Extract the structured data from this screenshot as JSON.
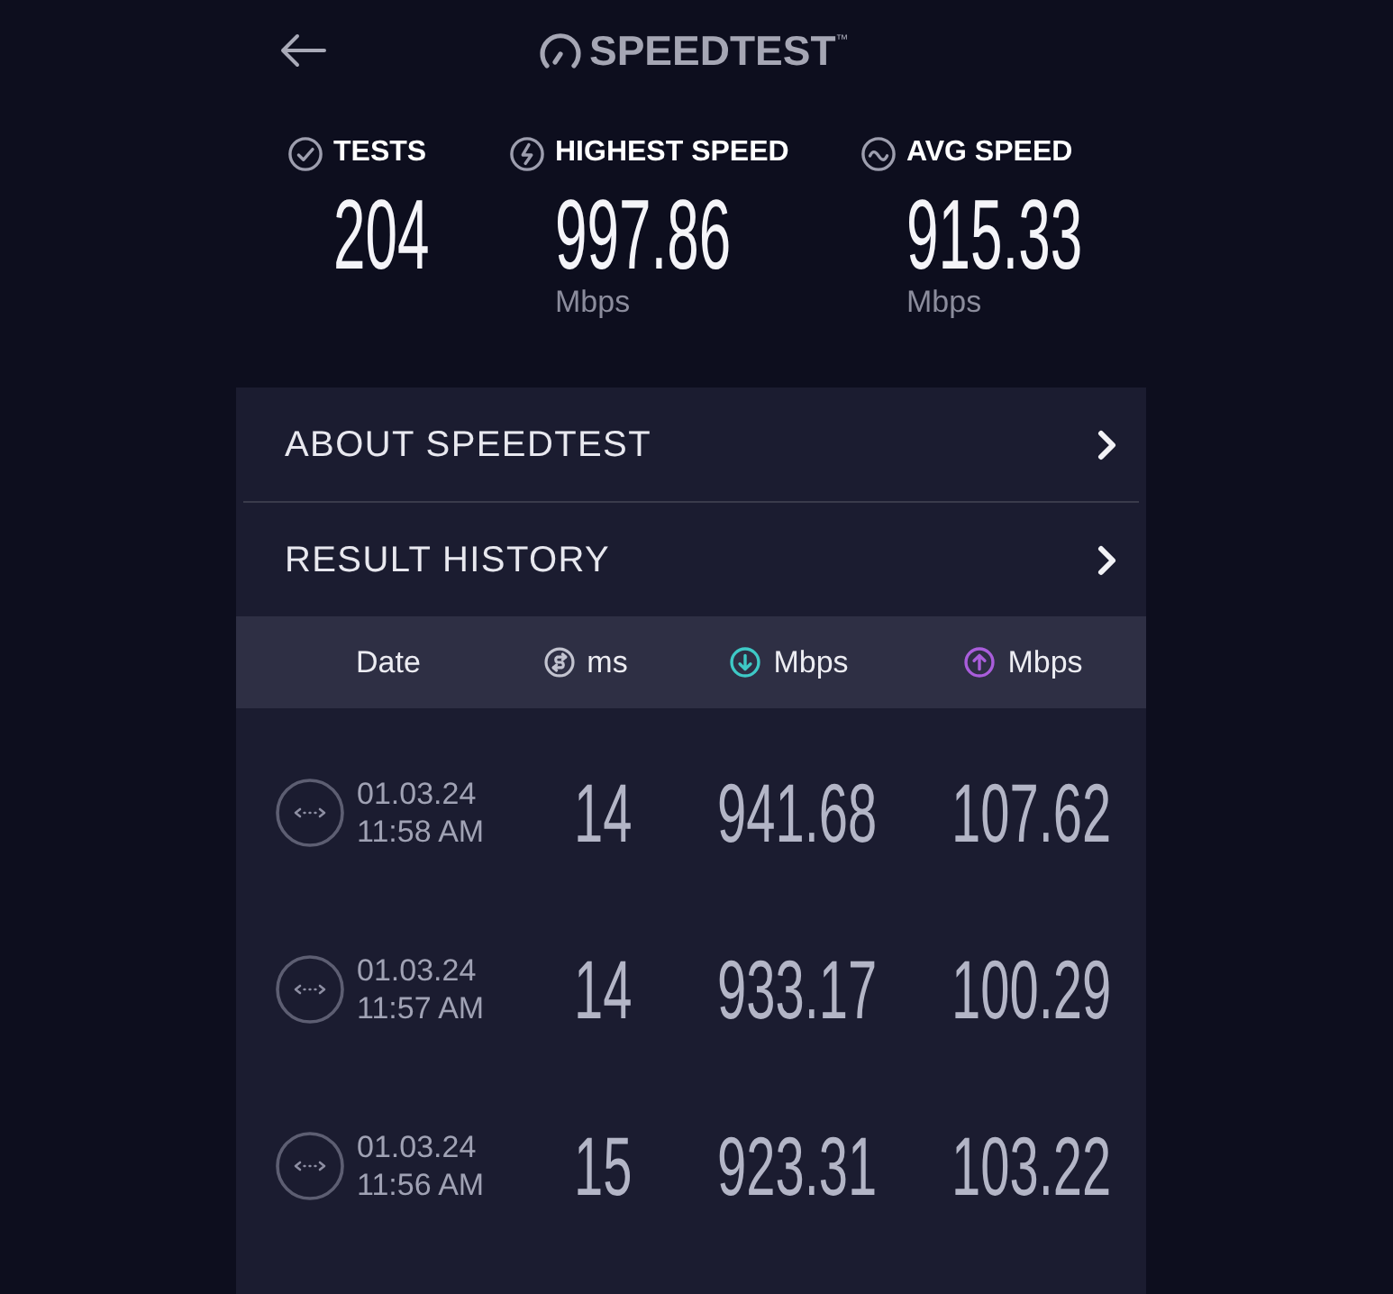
{
  "header": {
    "logo": "SPEEDTEST$^{™}$"
  },
  "stats": [
    {
      "kind": "tests",
      "label": "TESTS",
      "value": "204"
    },
    {
      "kind": "highest",
      "label": "HIGHEST SPEED",
      "value": "997.86",
      "unit": "Mbps"
    },
    {
      "kind": "average",
      "label": "AVG SPEED",
      "value": "915.33",
      "unit": "Mbps"
    }
  ],
  "menu": [
    {
      "label": "ABOUT SPEEDTEST"
    },
    {
      "label": "RESULT HISTORY"
    }
  ],
  "table": {
    "columns": [
      {
        "kind": "date",
        "label": "Date"
      },
      {
        "kind": "ping",
        "label": "ms"
      },
      {
        "kind": "download",
        "label": "Mbps"
      },
      {
        "kind": "upload",
        "label": "Mbps"
      }
    ],
    "rows": [
      {
        "date": "01.03.24",
        "time": "11:58 AM",
        "ping": "14",
        "download": "941.68",
        "upload": "107.62"
      },
      {
        "date": "01.03.24",
        "time": "11:57 AM",
        "ping": "14",
        "download": "933.17",
        "upload": "100.29"
      },
      {
        "date": "01.03.24",
        "time": "11:56 AM",
        "ping": "15",
        "download": "923.31",
        "upload": "103.22"
      }
    ]
  }
}
